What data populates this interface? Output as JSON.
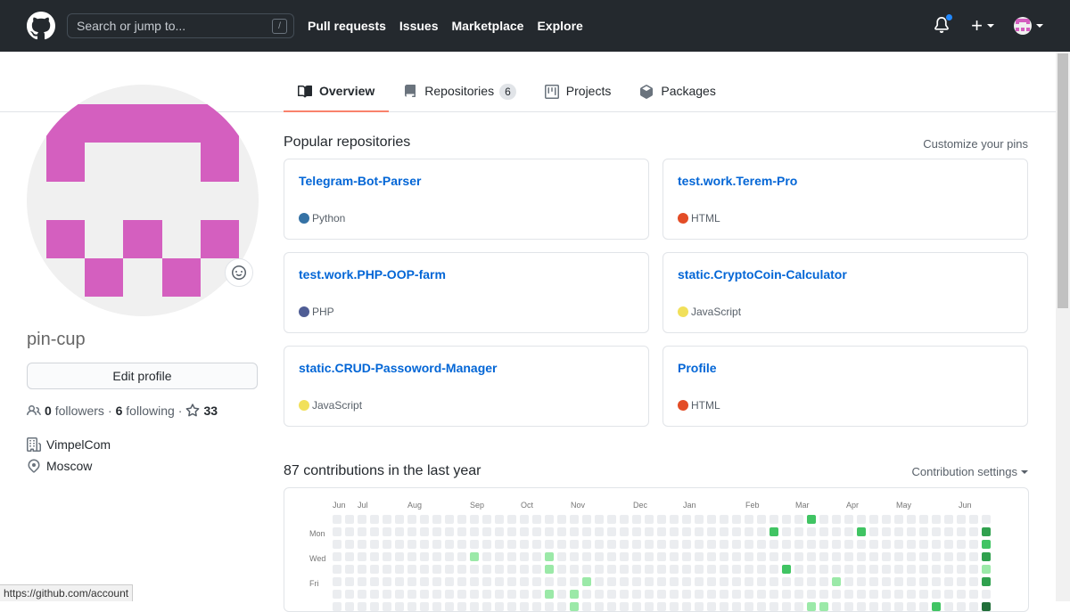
{
  "header": {
    "search_placeholder": "Search or jump to...",
    "search_shortcut": "/",
    "nav": [
      "Pull requests",
      "Issues",
      "Marketplace",
      "Explore"
    ],
    "plus": "+"
  },
  "tabs": [
    {
      "label": "Overview",
      "icon": "book-icon",
      "active": true
    },
    {
      "label": "Repositories",
      "icon": "repo-icon",
      "count": "6"
    },
    {
      "label": "Projects",
      "icon": "project-icon"
    },
    {
      "label": "Packages",
      "icon": "package-icon"
    }
  ],
  "profile": {
    "username": "pin-cup",
    "edit_label": "Edit profile",
    "followers": "0",
    "followers_label": "followers",
    "following": "6",
    "following_label": "following",
    "stars": "33",
    "company": "VimpelCom",
    "location": "Moscow"
  },
  "popular": {
    "title": "Popular repositories",
    "customize": "Customize your pins",
    "repos": [
      {
        "name": "Telegram-Bot-Parser",
        "lang": "Python",
        "color": "#3572A5"
      },
      {
        "name": "test.work.Terem-Pro",
        "lang": "HTML",
        "color": "#e34c26"
      },
      {
        "name": "test.work.PHP-OOP-farm",
        "lang": "PHP",
        "color": "#4F5D95"
      },
      {
        "name": "static.CryptoCoin-Calculator",
        "lang": "JavaScript",
        "color": "#f1e05a"
      },
      {
        "name": "static.CRUD-Passoword-Manager",
        "lang": "JavaScript",
        "color": "#f1e05a"
      },
      {
        "name": "Profile",
        "lang": "HTML",
        "color": "#e34c26"
      }
    ]
  },
  "contributions": {
    "title": "87 contributions in the last year",
    "settings": "Contribution settings",
    "months": [
      "Jun",
      "Jul",
      "Aug",
      "Sep",
      "Oct",
      "Nov",
      "Dec",
      "Jan",
      "Feb",
      "Mar",
      "Apr",
      "May",
      "Jun"
    ],
    "days": [
      "Mon",
      "Wed",
      "Fri"
    ]
  },
  "status_url": "https://github.com/account",
  "colors": {
    "accent": "#f9826c",
    "link": "#0366d6",
    "avatar": "#d45fbf"
  }
}
